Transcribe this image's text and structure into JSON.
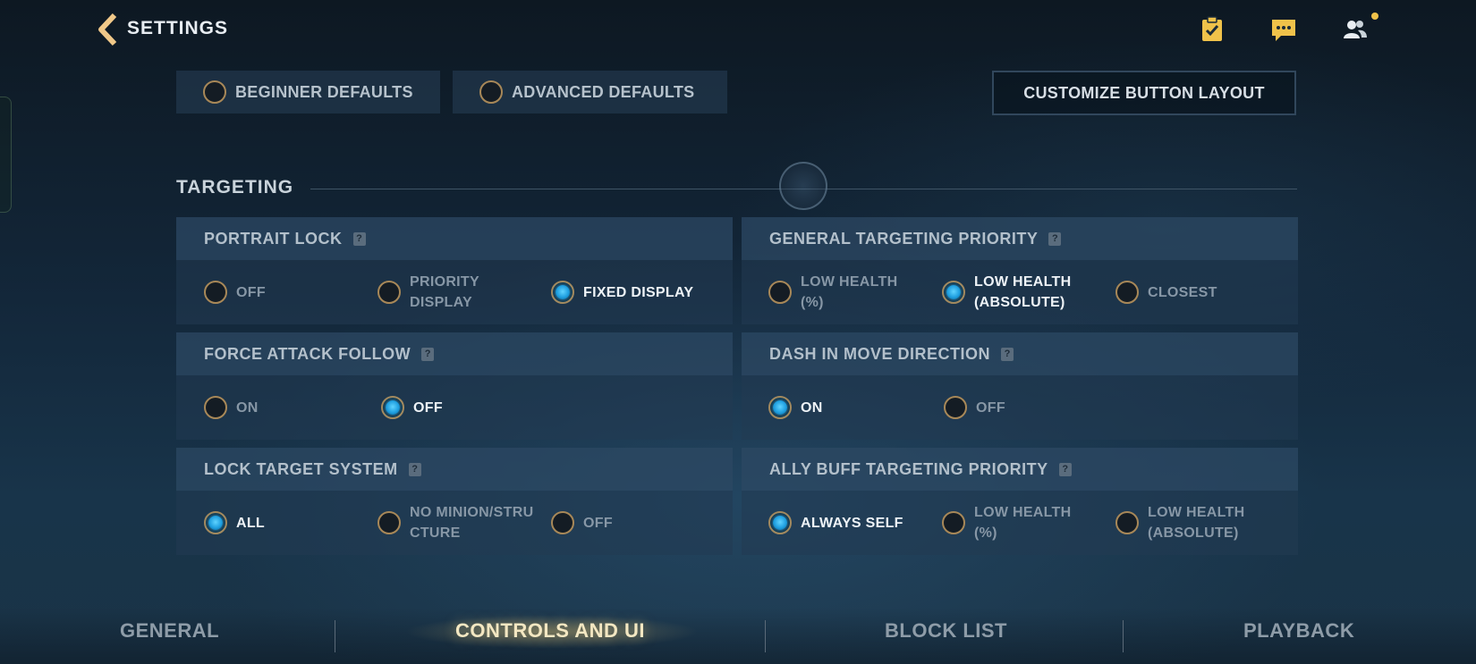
{
  "header": {
    "title": "SETTINGS"
  },
  "presets": {
    "beginner": "BEGINNER DEFAULTS",
    "advanced": "ADVANCED DEFAULTS",
    "customize": "CUSTOMIZE BUTTON LAYOUT"
  },
  "section": {
    "title": "TARGETING"
  },
  "settings": [
    {
      "title": "PORTRAIT LOCK",
      "options": [
        {
          "label": "OFF",
          "selected": false
        },
        {
          "label": "PRIORITY DISPLAY",
          "selected": false
        },
        {
          "label": "FIXED DISPLAY",
          "selected": true
        }
      ]
    },
    {
      "title": "GENERAL TARGETING PRIORITY",
      "options": [
        {
          "label": "LOW HEALTH (%)",
          "selected": false
        },
        {
          "label": "LOW HEALTH (ABSOLUTE)",
          "selected": true
        },
        {
          "label": "CLOSEST",
          "selected": false
        }
      ]
    },
    {
      "title": "FORCE ATTACK FOLLOW",
      "options": [
        {
          "label": "ON",
          "selected": false
        },
        {
          "label": "OFF",
          "selected": true
        }
      ]
    },
    {
      "title": "DASH IN MOVE DIRECTION",
      "options": [
        {
          "label": "ON",
          "selected": true
        },
        {
          "label": "OFF",
          "selected": false
        }
      ]
    },
    {
      "title": "LOCK TARGET SYSTEM",
      "options": [
        {
          "label": "ALL",
          "selected": true
        },
        {
          "label": "NO MINION/STRUCTURE",
          "selected": false
        },
        {
          "label": "OFF",
          "selected": false
        }
      ]
    },
    {
      "title": "ALLY BUFF TARGETING PRIORITY",
      "options": [
        {
          "label": "ALWAYS SELF",
          "selected": true
        },
        {
          "label": "LOW HEALTH (%)",
          "selected": false
        },
        {
          "label": "LOW HEALTH (ABSOLUTE)",
          "selected": false
        }
      ]
    }
  ],
  "help_glyph": "?",
  "icons": {
    "back": "chevron-left-icon",
    "missions": "clipboard-check-icon",
    "chat": "chat-bubble-icon",
    "friends": "friends-icon"
  },
  "nav": {
    "general": "GENERAL",
    "controls": "CONTROLS AND UI",
    "block": "BLOCK LIST",
    "playback": "PLAYBACK"
  },
  "colors": {
    "accent_gold": "#a88858",
    "radio_on": "#1f9fe0",
    "notification": "#f0c24a"
  }
}
